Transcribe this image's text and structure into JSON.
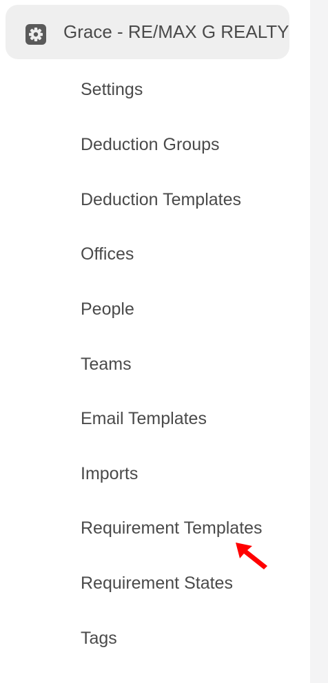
{
  "account": {
    "name": "Grace - RE/MAX G REALTY",
    "icon": "gear-icon"
  },
  "nav": {
    "items": [
      {
        "label": "Settings"
      },
      {
        "label": "Deduction Groups"
      },
      {
        "label": "Deduction Templates"
      },
      {
        "label": "Offices"
      },
      {
        "label": "People"
      },
      {
        "label": "Teams"
      },
      {
        "label": "Email Templates"
      },
      {
        "label": "Imports"
      },
      {
        "label": "Requirement Templates"
      },
      {
        "label": "Requirement States"
      },
      {
        "label": "Tags"
      }
    ]
  },
  "colors": {
    "text": "#4a4a4a",
    "header_bg": "#efefef",
    "icon": "#5a5a5a",
    "cursor": "#ff0000",
    "side_panel": "#f4f4f5"
  }
}
